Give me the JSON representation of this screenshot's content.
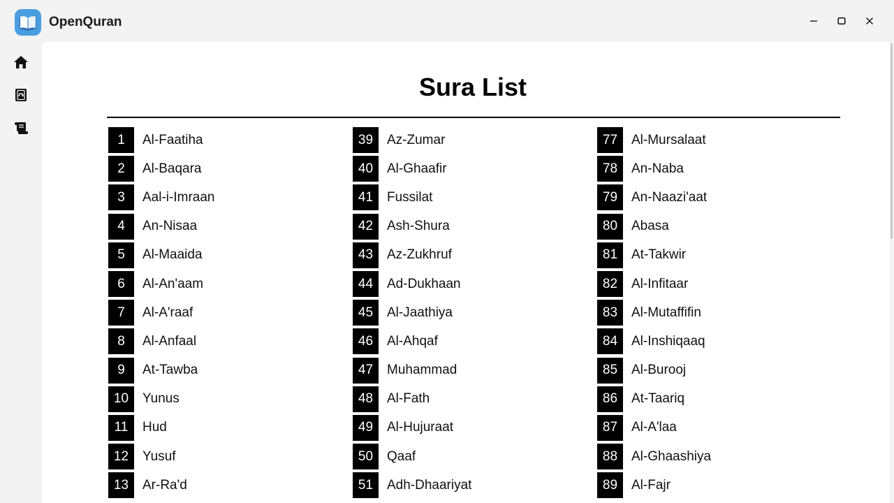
{
  "app": {
    "title": "OpenQuran",
    "logo_icon": "open-book-icon",
    "accent_color": "#4a9ee0"
  },
  "window_controls": {
    "minimize_icon": "minimize-icon",
    "maximize_icon": "maximize-icon",
    "close_icon": "close-icon"
  },
  "sidebar": {
    "items": [
      {
        "icon": "home-icon"
      },
      {
        "icon": "quran-book-icon"
      },
      {
        "icon": "scroll-icon"
      }
    ]
  },
  "main": {
    "title": "Sura List",
    "columns": [
      [
        {
          "num": "1",
          "name": "Al-Faatiha"
        },
        {
          "num": "2",
          "name": "Al-Baqara"
        },
        {
          "num": "3",
          "name": "Aal-i-Imraan"
        },
        {
          "num": "4",
          "name": "An-Nisaa"
        },
        {
          "num": "5",
          "name": "Al-Maaida"
        },
        {
          "num": "6",
          "name": "Al-An'aam"
        },
        {
          "num": "7",
          "name": "Al-A'raaf"
        },
        {
          "num": "8",
          "name": "Al-Anfaal"
        },
        {
          "num": "9",
          "name": "At-Tawba"
        },
        {
          "num": "10",
          "name": "Yunus"
        },
        {
          "num": "11",
          "name": "Hud"
        },
        {
          "num": "12",
          "name": "Yusuf"
        },
        {
          "num": "13",
          "name": "Ar-Ra'd"
        }
      ],
      [
        {
          "num": "39",
          "name": "Az-Zumar"
        },
        {
          "num": "40",
          "name": "Al-Ghaafir"
        },
        {
          "num": "41",
          "name": "Fussilat"
        },
        {
          "num": "42",
          "name": "Ash-Shura"
        },
        {
          "num": "43",
          "name": "Az-Zukhruf"
        },
        {
          "num": "44",
          "name": "Ad-Dukhaan"
        },
        {
          "num": "45",
          "name": "Al-Jaathiya"
        },
        {
          "num": "46",
          "name": "Al-Ahqaf"
        },
        {
          "num": "47",
          "name": "Muhammad"
        },
        {
          "num": "48",
          "name": "Al-Fath"
        },
        {
          "num": "49",
          "name": "Al-Hujuraat"
        },
        {
          "num": "50",
          "name": "Qaaf"
        },
        {
          "num": "51",
          "name": "Adh-Dhaariyat"
        }
      ],
      [
        {
          "num": "77",
          "name": "Al-Mursalaat"
        },
        {
          "num": "78",
          "name": "An-Naba"
        },
        {
          "num": "79",
          "name": "An-Naazi'aat"
        },
        {
          "num": "80",
          "name": "Abasa"
        },
        {
          "num": "81",
          "name": "At-Takwir"
        },
        {
          "num": "82",
          "name": "Al-Infitaar"
        },
        {
          "num": "83",
          "name": "Al-Mutaffifin"
        },
        {
          "num": "84",
          "name": "Al-Inshiqaaq"
        },
        {
          "num": "85",
          "name": "Al-Burooj"
        },
        {
          "num": "86",
          "name": "At-Taariq"
        },
        {
          "num": "87",
          "name": "Al-A'laa"
        },
        {
          "num": "88",
          "name": "Al-Ghaashiya"
        },
        {
          "num": "89",
          "name": "Al-Fajr"
        }
      ]
    ]
  }
}
